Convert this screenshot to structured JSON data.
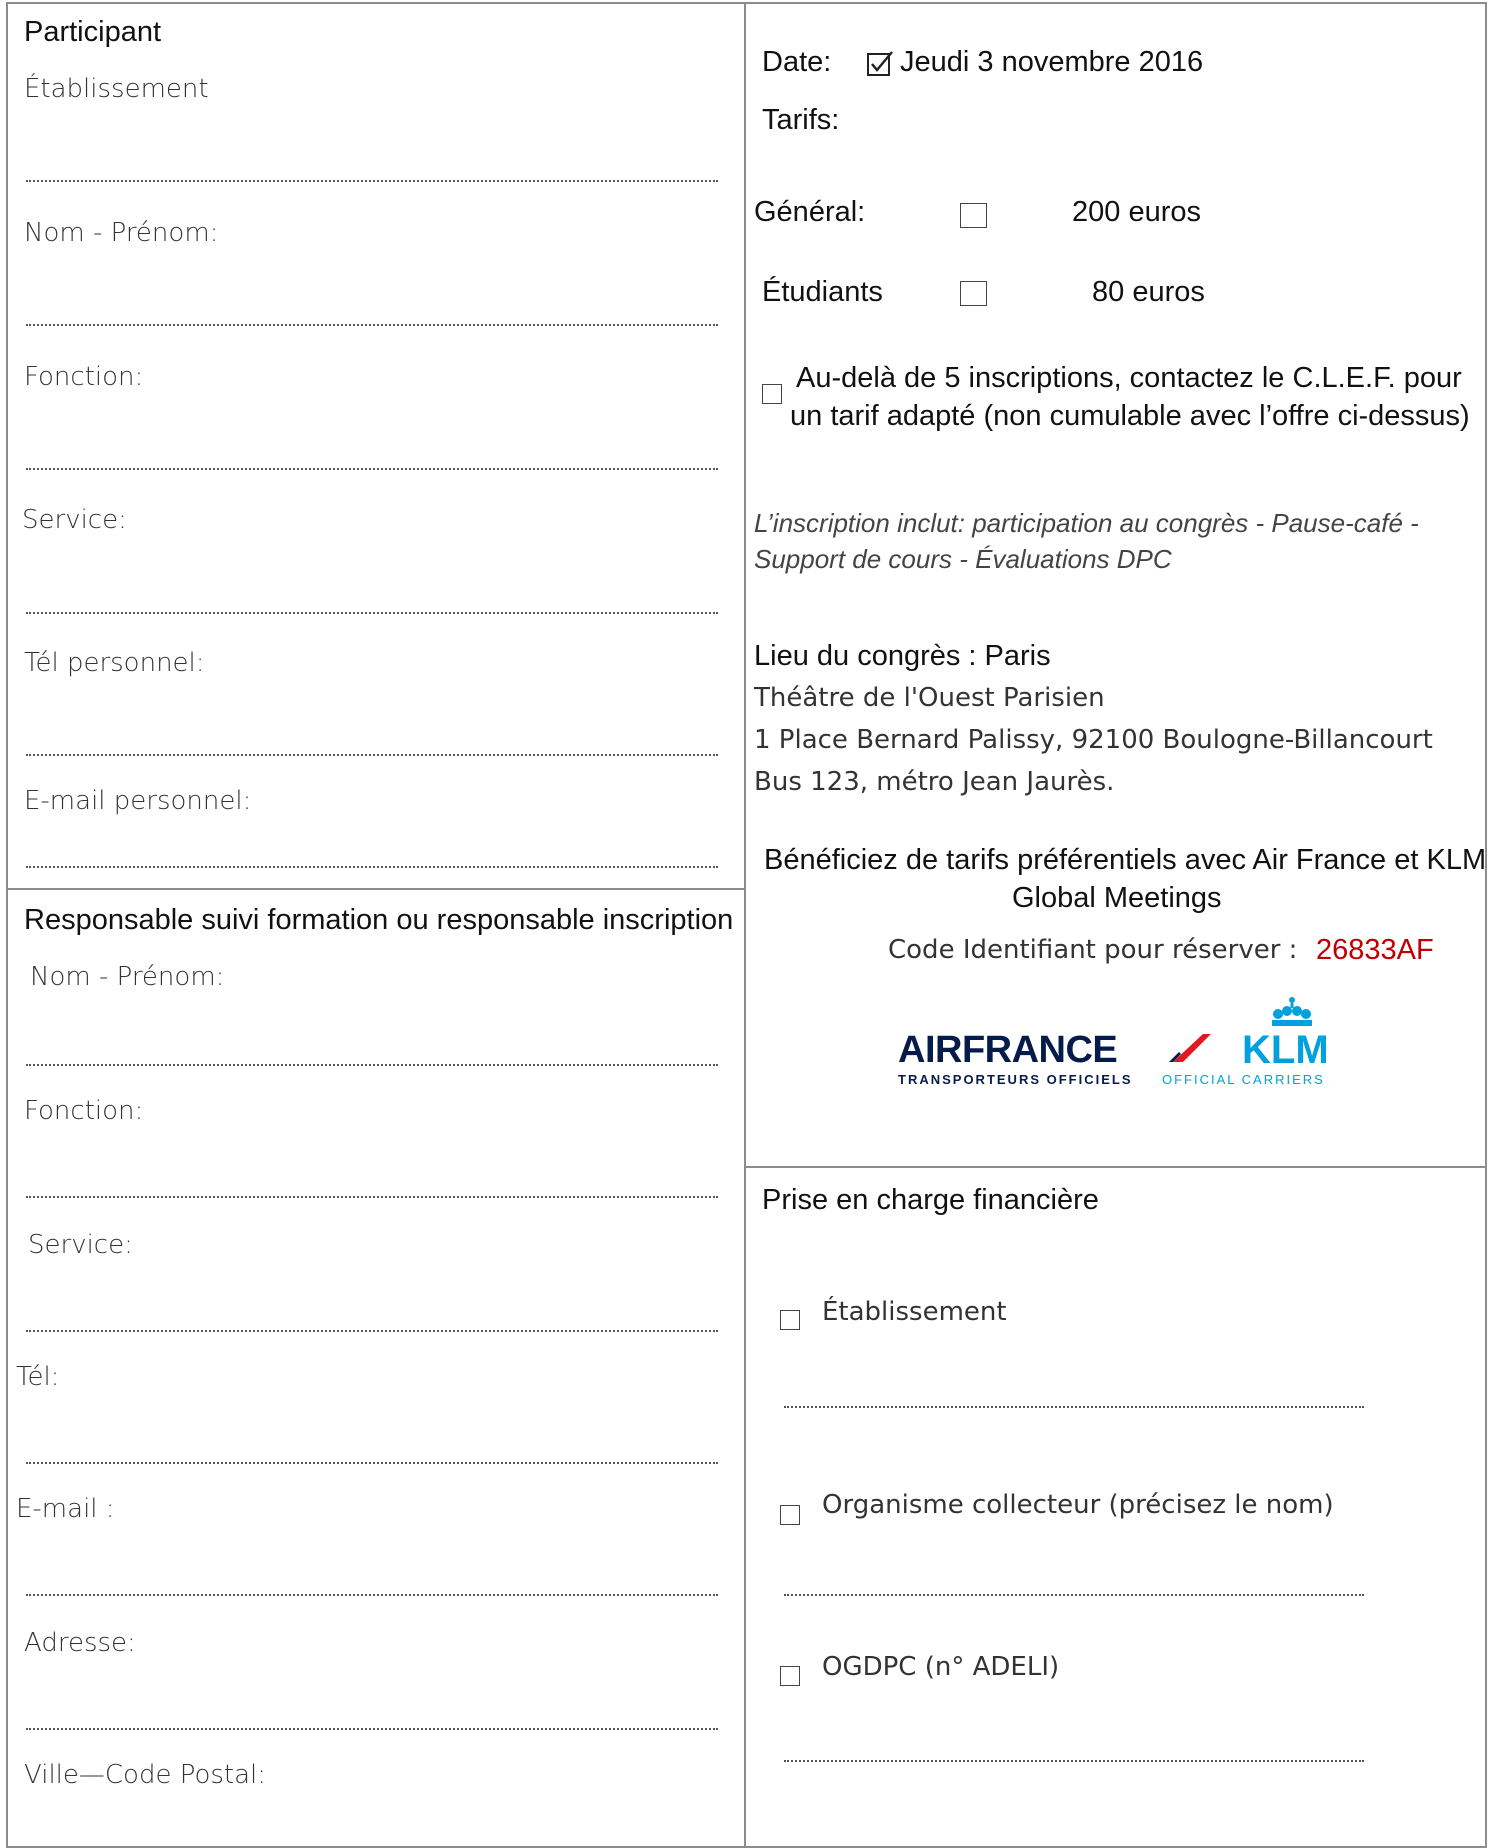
{
  "participant": {
    "title": "Participant",
    "fields": [
      "Établissement",
      "Nom - Prénom:",
      "Fonction:",
      "Service:",
      "Tél personnel:",
      "E-mail personnel:"
    ]
  },
  "responsable": {
    "title": "Responsable suivi formation ou responsable inscription",
    "fields": [
      "Nom - Prénom:",
      "Fonction:",
      "Service:",
      "Tél:",
      "E-mail :",
      "Adresse:",
      "Ville—Code Postal:"
    ]
  },
  "info": {
    "date_label": "Date:",
    "date_value": "Jeudi 3 novembre 2016",
    "tarifs_label": "Tarifs:",
    "general_label": "Général:",
    "general_price": "200 euros",
    "etudiants_label": "Étudiants",
    "etudiants_price": "80 euros",
    "group_line1": "Au-delà de 5 inscriptions, contactez le C.L.E.F. pour",
    "group_line2": "un tarif adapté (non cumulable avec l’offre ci-dessus)",
    "includes_line1": "L’inscription inclut: participation  au congrès - Pause-café -",
    "includes_line2": "Support de cours - Évaluations DPC",
    "lieu_title": "Lieu du congrès : Paris",
    "lieu_line1": "Théâtre de l'Ouest Parisien",
    "lieu_line2": "1 Place Bernard Palissy, 92100 Boulogne-Billancourt",
    "lieu_line3": "Bus 123, métro Jean Jaurès.",
    "promo_line1": "Bénéficiez de tarifs préférentiels avec Air France et KLM",
    "promo_line2": "Global Meetings",
    "code_label": "Code Identifiant pour réserver :",
    "code_value": "26833AF",
    "logo_af": "AIRFRANCE",
    "logo_klm": "KLM",
    "logo_sub1": "TRANSPORTEURS OFFICIELS",
    "logo_sub2": "OFFICIAL CARRIERS"
  },
  "financement": {
    "title": "Prise en charge financière",
    "options": [
      "Établissement",
      "Organisme collecteur (précisez le nom)",
      "OGDPC  (n° ADELI)"
    ]
  },
  "colors": {
    "border": "#8c8c8c",
    "code_red": "#c00000",
    "af_navy": "#051c4b",
    "af_red": "#e01a22",
    "klm_blue": "#00a1de"
  },
  "checkbox_states": {
    "date": "checked",
    "general": "unchecked",
    "etudiants": "unchecked",
    "group": "unchecked",
    "fin_etab": "unchecked",
    "fin_org": "unchecked",
    "fin_ogdpc": "unchecked"
  }
}
